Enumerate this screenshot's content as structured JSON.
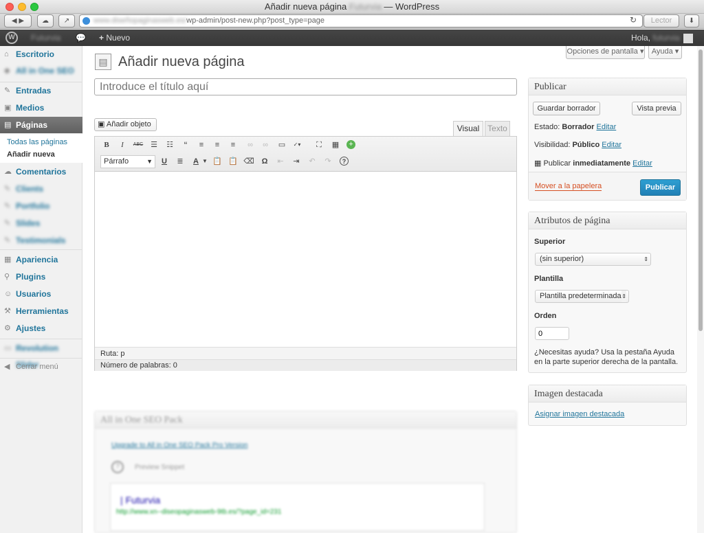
{
  "browser": {
    "title_main": "Añadir nueva página",
    "title_blurred": "Futurvia",
    "title_app": "— WordPress",
    "url_blurred": "www.diseñopaginasweb.es/",
    "url": "wp-admin/post-new.php?post_type=page",
    "reader_label": "Lector"
  },
  "adminbar": {
    "site_blurred": "Futurvia",
    "new_label": "Nuevo",
    "greeting": "Hola,",
    "user_blurred": "futurvia"
  },
  "sidebar": {
    "escritorio": "Escritorio",
    "seo_blurred": "All in One SEO",
    "entradas": "Entradas",
    "medios": "Medios",
    "paginas": "Páginas",
    "sub_todas": "Todas las páginas",
    "sub_nueva": "Añadir nueva",
    "comentarios": "Comentarios",
    "clients_blurred": "Clients",
    "portfolio_blurred": "Portfolio",
    "slides_blurred": "Slides",
    "testimonials_blurred": "Testimonials",
    "apariencia": "Apariencia",
    "plugins": "Plugins",
    "usuarios": "Usuarios",
    "herramientas": "Herramientas",
    "ajustes": "Ajustes",
    "revslider_blurred": "Revolution Slider",
    "collapse": "Cerrar menú"
  },
  "screen_options": "Opciones de pantalla",
  "help": "Ayuda",
  "page_title": "Añadir nueva página",
  "title_placeholder": "Introduce el título aquí",
  "add_media": "Añadir objeto",
  "tab_visual": "Visual",
  "tab_text": "Texto",
  "format_select": "Párrafo",
  "path": "Ruta: p",
  "word_count": "Número de palabras: 0",
  "seo_box": {
    "title_blurred": "All in One SEO Pack",
    "upgrade_blurred": "Upgrade to All in One SEO Pack Pro Version",
    "preview_blurred": "Preview Snippet",
    "snippet_title_blurred": "| Futurvia",
    "snippet_url_blurred": "http://www.xn--diseopaginasweb-9tb.es/?page_id=231"
  },
  "publish": {
    "title": "Publicar",
    "save_draft": "Guardar borrador",
    "preview": "Vista previa",
    "status_label": "Estado:",
    "status_value": "Borrador",
    "visibility_label": "Visibilidad:",
    "visibility_value": "Público",
    "publish_label": "Publicar",
    "publish_value": "inmediatamente",
    "edit": "Editar",
    "trash": "Mover a la papelera",
    "publish_button": "Publicar"
  },
  "attributes": {
    "title": "Atributos de página",
    "parent_label": "Superior",
    "parent_value": "(sin superior)",
    "template_label": "Plantilla",
    "template_value": "Plantilla predeterminada",
    "order_label": "Orden",
    "order_value": "0",
    "help_text": "¿Necesitas ayuda? Usa la pestaña Ayuda en la parte superior derecha de la pantalla."
  },
  "featured": {
    "title": "Imagen destacada",
    "link": "Asignar imagen destacada"
  },
  "colors": {
    "link": "#21759b",
    "publish_button": "#2e8bc6",
    "trash": "#d54e21",
    "admin_bar": "#464646"
  }
}
